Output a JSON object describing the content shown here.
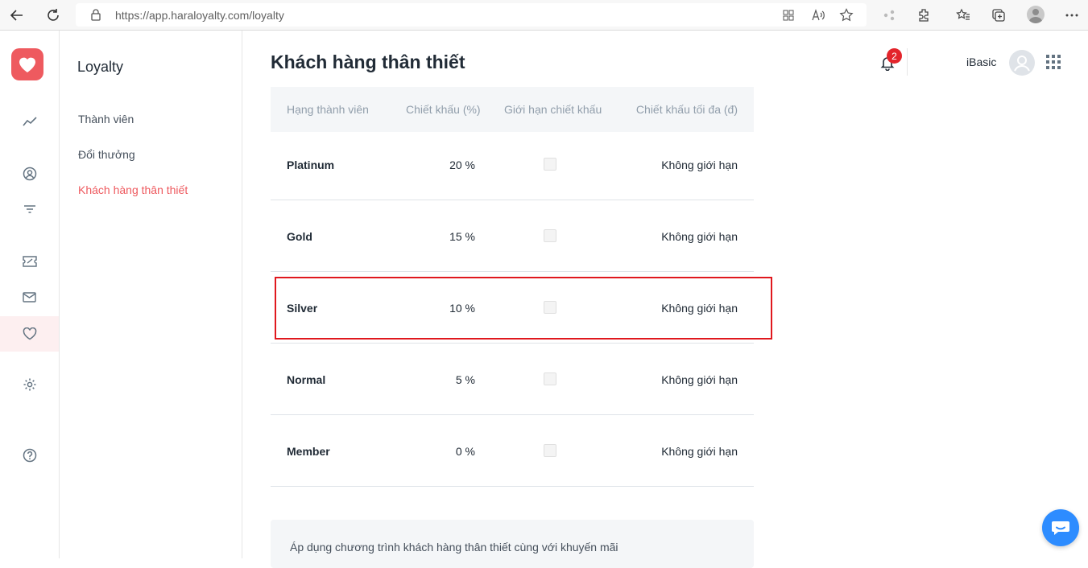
{
  "browser": {
    "url": "https://app.haraloyalty.com/loyalty"
  },
  "subnav": {
    "title": "Loyalty",
    "items": [
      {
        "label": "Thành viên"
      },
      {
        "label": "Đổi thưởng"
      },
      {
        "label": "Khách hàng thân thiết"
      }
    ]
  },
  "header": {
    "title": "Khách hàng thân thiết",
    "notification_count": "2",
    "username": "iBasic"
  },
  "table": {
    "columns": [
      "Hạng thành viên",
      "Chiết khấu (%)",
      "Giới hạn chiết khấu",
      "Chiết khấu tối đa (đ)"
    ],
    "rows": [
      {
        "tier": "Platinum",
        "discount": "20 %",
        "limit": "Không giới hạn"
      },
      {
        "tier": "Gold",
        "discount": "15 %",
        "limit": "Không giới hạn"
      },
      {
        "tier": "Silver",
        "discount": "10 %",
        "limit": "Không giới hạn"
      },
      {
        "tier": "Normal",
        "discount": "5 %",
        "limit": "Không giới hạn"
      },
      {
        "tier": "Member",
        "discount": "0 %",
        "limit": "Không giới hạn"
      }
    ]
  },
  "promo": {
    "text": "Áp dụng chương trình khách hàng thân thiết cùng với khuyến mãi"
  },
  "colors": {
    "accent": "#ee5a5f",
    "highlight": "#e0181e",
    "chat": "#2d8cff"
  },
  "icons": [
    "back-icon",
    "refresh-icon",
    "lock-icon",
    "heart-icon",
    "trend-icon",
    "user-icon",
    "filter-icon",
    "ticket-icon",
    "mail-icon",
    "settings-icon",
    "help-icon",
    "bell-icon",
    "apps-icon",
    "chat-icon"
  ]
}
